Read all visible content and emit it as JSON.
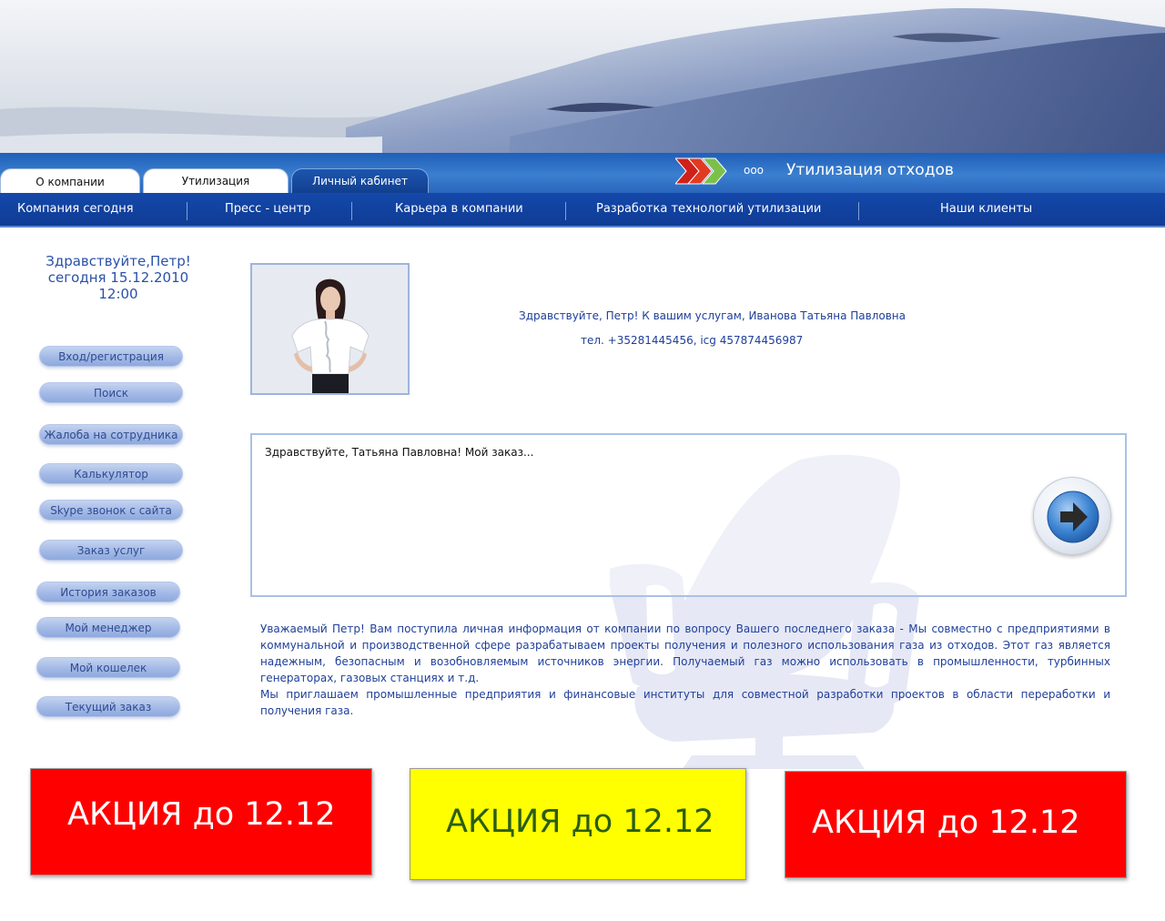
{
  "tabs": [
    {
      "label": "О компании"
    },
    {
      "label": "Утилизация"
    },
    {
      "label": "Личный кабинет"
    }
  ],
  "brand": {
    "prefix": "ооо",
    "name": "Утилизация отходов"
  },
  "nav": [
    {
      "label": "Компания сегодня"
    },
    {
      "label": "Пресс - центр"
    },
    {
      "label": "Карьера в компании"
    },
    {
      "label": "Разработка технологий утилизации"
    },
    {
      "label": "Наши клиенты"
    }
  ],
  "greeting": {
    "hello": "Здравствуйте,Петр!",
    "date": "сегодня 15.12.2010",
    "time": "12:00"
  },
  "menu": [
    {
      "label": "Вход/регистрация"
    },
    {
      "label": "Поиск"
    },
    {
      "label": "Жалоба на сотрудника"
    },
    {
      "label": "Калькулятор"
    },
    {
      "label": "Skype звонок с сайта"
    },
    {
      "label": "Заказ услуг"
    },
    {
      "label": "История заказов"
    },
    {
      "label": "Мой менеджер"
    },
    {
      "label": "Мой кошелек"
    },
    {
      "label": "Текущий заказ"
    }
  ],
  "manager": {
    "line": "Здравствуйте, Петр! К вашим услугам, Иванова Татьяна Павловна",
    "contact": "тел. +35281445456, icg 457874456987"
  },
  "message": {
    "text": "Здравствуйте, Татьяна Павловна!  Мой заказ..."
  },
  "info": {
    "p1": "Уважаемый Петр! Вам поступила личная информация от компании по вопросу Вашего последнего заказа - Мы  совместно с предприятиями в коммунальной и производственной сфере разрабатываем проекты получения и полезного использования газа из отходов. Этот газ является надежным, безопасным и возобновляемым источников энергии. Получаемый газ можно использовать в промышленности, турбинных генераторах, газовых станциях и т.д.",
    "p2": "Мы приглашаем промышленные предприятия и финансовые институты для совместной разработки проектов в области переработки и получения газа."
  },
  "promos": [
    {
      "label": "АКЦИЯ до 12.12",
      "color": "#ff0000"
    },
    {
      "label": "АКЦИЯ до 12.12",
      "color": "#ffff00"
    },
    {
      "label": "АКЦИЯ до 12.12",
      "color": "#ff0000"
    }
  ]
}
